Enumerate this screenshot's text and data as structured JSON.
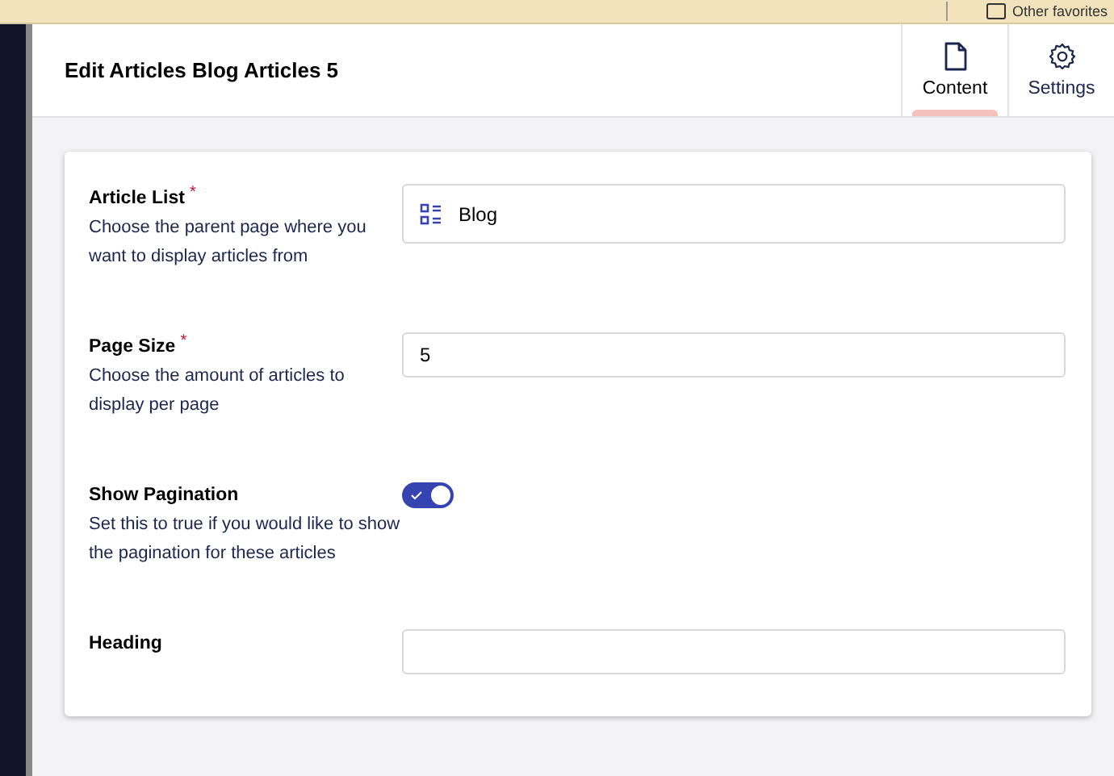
{
  "browser_bar": {
    "bookmark": "Other favorites"
  },
  "header": {
    "title": "Edit Articles Blog Articles 5"
  },
  "tabs": [
    {
      "label": "Content",
      "selected": true
    },
    {
      "label": "Settings",
      "selected": false
    }
  ],
  "fields": [
    {
      "kind": "picker",
      "label": "Article List",
      "required_mark": "*",
      "description": "Choose the parent page where you want to display articles from",
      "value": "Blog"
    },
    {
      "kind": "text",
      "label": "Page Size",
      "required_mark": "*",
      "description": "Choose the amount of articles to display per page",
      "value": "5"
    },
    {
      "kind": "toggle",
      "label": "Show Pagination",
      "description": "Set this to true if you would like to show the pagination for these articles",
      "on": true
    },
    {
      "kind": "text",
      "label": "Heading"
    }
  ]
}
